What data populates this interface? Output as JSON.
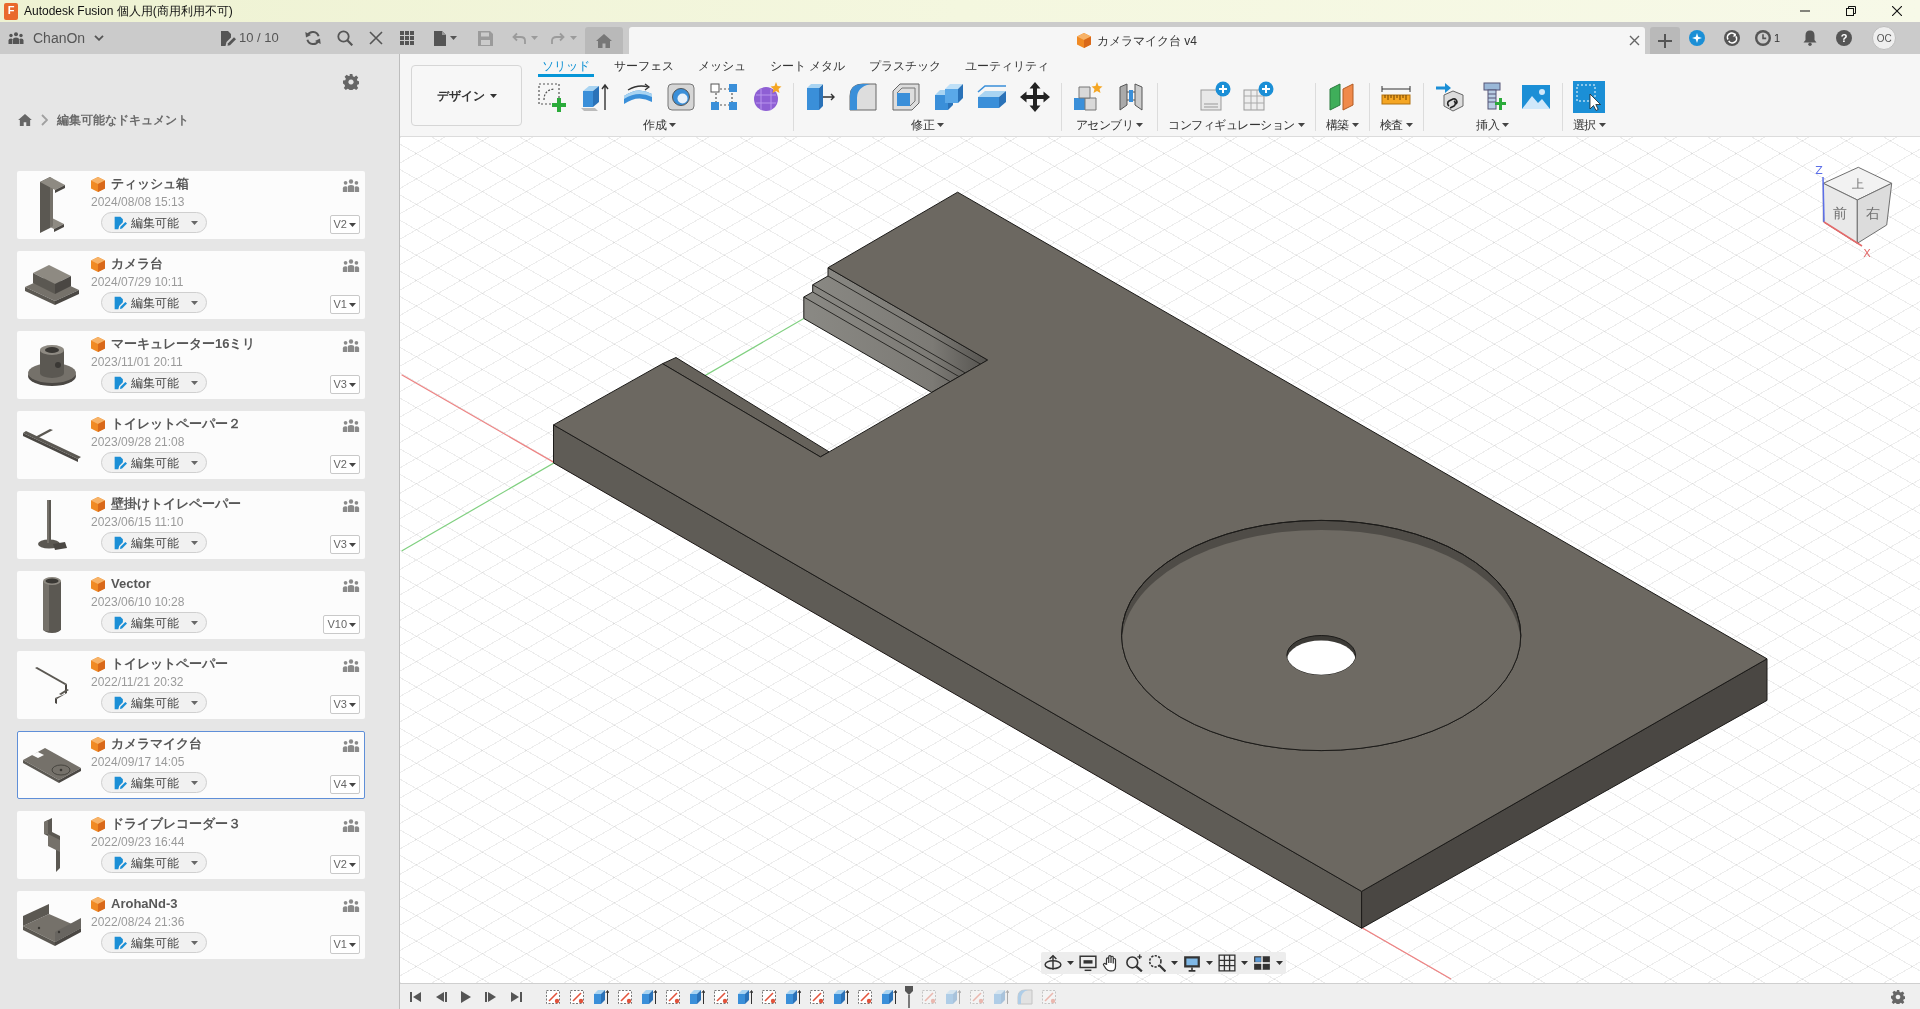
{
  "window": {
    "logo": "F",
    "title": "Autodesk Fusion 個人用(商用利用不可)"
  },
  "top_bar": {
    "team": "ChanOn",
    "document_count": "10 / 10",
    "save_disabled": true,
    "undo_disabled": true,
    "redo_disabled": true,
    "document_tab": {
      "title": "カメラマイク台 v4"
    },
    "job_count": "1",
    "help": "?",
    "avatar": "OC"
  },
  "sidebar": {
    "breadcrumb": "編集可能なドキュメント",
    "documents": [
      {
        "kind": "bracket",
        "name": "ティッシュ箱",
        "date": "2024/08/08 15:13",
        "status": "編集可能",
        "version": "V2",
        "selected": false
      },
      {
        "kind": "block",
        "name": "カメラ台",
        "date": "2024/07/29 10:11",
        "status": "編集可能",
        "version": "V1",
        "selected": false
      },
      {
        "kind": "flange",
        "name": "マーキュレーター16ミリ",
        "date": "2023/11/01 20:11",
        "status": "編集可能",
        "version": "V3",
        "selected": false
      },
      {
        "kind": "bar",
        "name": "トイレットペーパー２",
        "date": "2023/09/28 21:08",
        "status": "編集可能",
        "version": "V2",
        "selected": false
      },
      {
        "kind": "stand",
        "name": "壁掛けトイレペーパー",
        "date": "2023/06/15 11:10",
        "status": "編集可能",
        "version": "V3",
        "selected": false
      },
      {
        "kind": "tube",
        "name": "Vector",
        "date": "2023/06/10 10:28",
        "status": "編集可能",
        "version": "V10",
        "selected": false
      },
      {
        "kind": "hook",
        "name": "トイレットペーパー",
        "date": "2022/11/21 20:32",
        "status": "編集可能",
        "version": "V3",
        "selected": false
      },
      {
        "kind": "plate",
        "name": "カメラマイク台",
        "date": "2024/09/17 14:05",
        "status": "編集可能",
        "version": "V4",
        "selected": true
      },
      {
        "kind": "clip",
        "name": "ドライブレコーダー３",
        "date": "2022/09/23 16:44",
        "status": "編集可能",
        "version": "V2",
        "selected": false
      },
      {
        "kind": "tray",
        "name": "ArohaNd-3",
        "date": "2022/08/24 21:36",
        "status": "編集可能",
        "version": "V1",
        "selected": false
      }
    ]
  },
  "toolbar": {
    "workspace": "デザイン",
    "tabs": [
      {
        "label": "ソリッド",
        "selected": true
      },
      {
        "label": "サーフェス",
        "selected": false
      },
      {
        "label": "メッシュ",
        "selected": false
      },
      {
        "label": "シート メタル",
        "selected": false
      },
      {
        "label": "プラスチック",
        "selected": false
      },
      {
        "label": "ユーティリティ",
        "selected": false
      }
    ],
    "groups": [
      "作成",
      "修正",
      "アセンブリ",
      "コンフィギュレーション",
      "構築",
      "検査",
      "挿入",
      "選択"
    ]
  },
  "view_cube": {
    "top": "上",
    "front": "前",
    "right": "右",
    "z_axis": "Z",
    "x_axis": "X"
  },
  "timeline": {
    "features": [
      {
        "kind": "sketch",
        "rolled_back": false
      },
      {
        "kind": "sketch",
        "rolled_back": false
      },
      {
        "kind": "extrude",
        "rolled_back": false
      },
      {
        "kind": "sketch",
        "rolled_back": false
      },
      {
        "kind": "extrude",
        "rolled_back": false
      },
      {
        "kind": "sketch",
        "rolled_back": false
      },
      {
        "kind": "extrude",
        "rolled_back": false
      },
      {
        "kind": "sketch",
        "rolled_back": false
      },
      {
        "kind": "extrude",
        "rolled_back": false
      },
      {
        "kind": "sketch",
        "rolled_back": false
      },
      {
        "kind": "extrude",
        "rolled_back": false
      },
      {
        "kind": "sketch",
        "rolled_back": false
      },
      {
        "kind": "extrude",
        "rolled_back": false
      },
      {
        "kind": "sketch",
        "rolled_back": false
      },
      {
        "kind": "extrude",
        "rolled_back": false
      },
      {
        "kind": "sketch",
        "rolled_back": true
      },
      {
        "kind": "extrude",
        "rolled_back": true
      },
      {
        "kind": "sketch",
        "rolled_back": true
      },
      {
        "kind": "extrude",
        "rolled_back": true
      },
      {
        "kind": "fillet",
        "rolled_back": true
      },
      {
        "kind": "sketch",
        "rolled_back": true
      }
    ]
  }
}
